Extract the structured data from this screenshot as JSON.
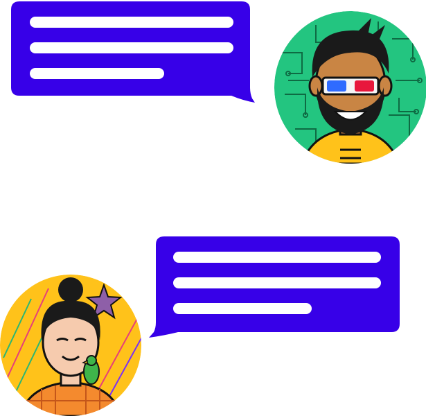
{
  "colors": {
    "bubble": "#3700E8",
    "placeholder_line": "#FFFFFF",
    "avatar_1_background": "#23C580",
    "avatar_1_circuit": "#0E6B43",
    "avatar_2_background": "#FFC21A",
    "avatar_2_streaks": "#E63E7B"
  },
  "messages": [
    {
      "sender": "avatar-bearded-man",
      "alignment": "left",
      "placeholder_lines": 3
    },
    {
      "sender": "avatar-woman-with-parrot",
      "alignment": "right",
      "placeholder_lines": 3
    }
  ]
}
